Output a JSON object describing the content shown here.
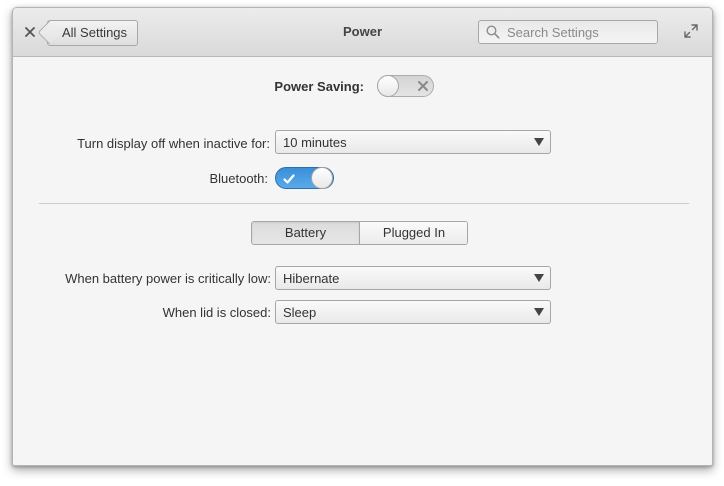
{
  "window": {
    "title": "Power",
    "back_label": "All Settings",
    "search_placeholder": "Search Settings"
  },
  "power_saving": {
    "label": "Power Saving:",
    "enabled": false
  },
  "display_off": {
    "label": "Turn display off when inactive for:",
    "value": "10 minutes"
  },
  "bluetooth": {
    "label": "Bluetooth:",
    "enabled": true
  },
  "tabs": [
    {
      "label": "Battery",
      "active": true
    },
    {
      "label": "Plugged In",
      "active": false
    }
  ],
  "battery_critical": {
    "label": "When battery power is critically low:",
    "value": "Hibernate"
  },
  "lid_closed": {
    "label": "When lid is closed:",
    "value": "Sleep"
  },
  "colors": {
    "accent": "#3b8fd8",
    "window_bg": "#f5f5f5",
    "header_bg": "#dedede"
  },
  "icons": [
    "close-icon",
    "back-arrow",
    "search-icon",
    "maximize-icon",
    "x-icon",
    "checkmark-icon",
    "dropdown-arrow-icon"
  ]
}
